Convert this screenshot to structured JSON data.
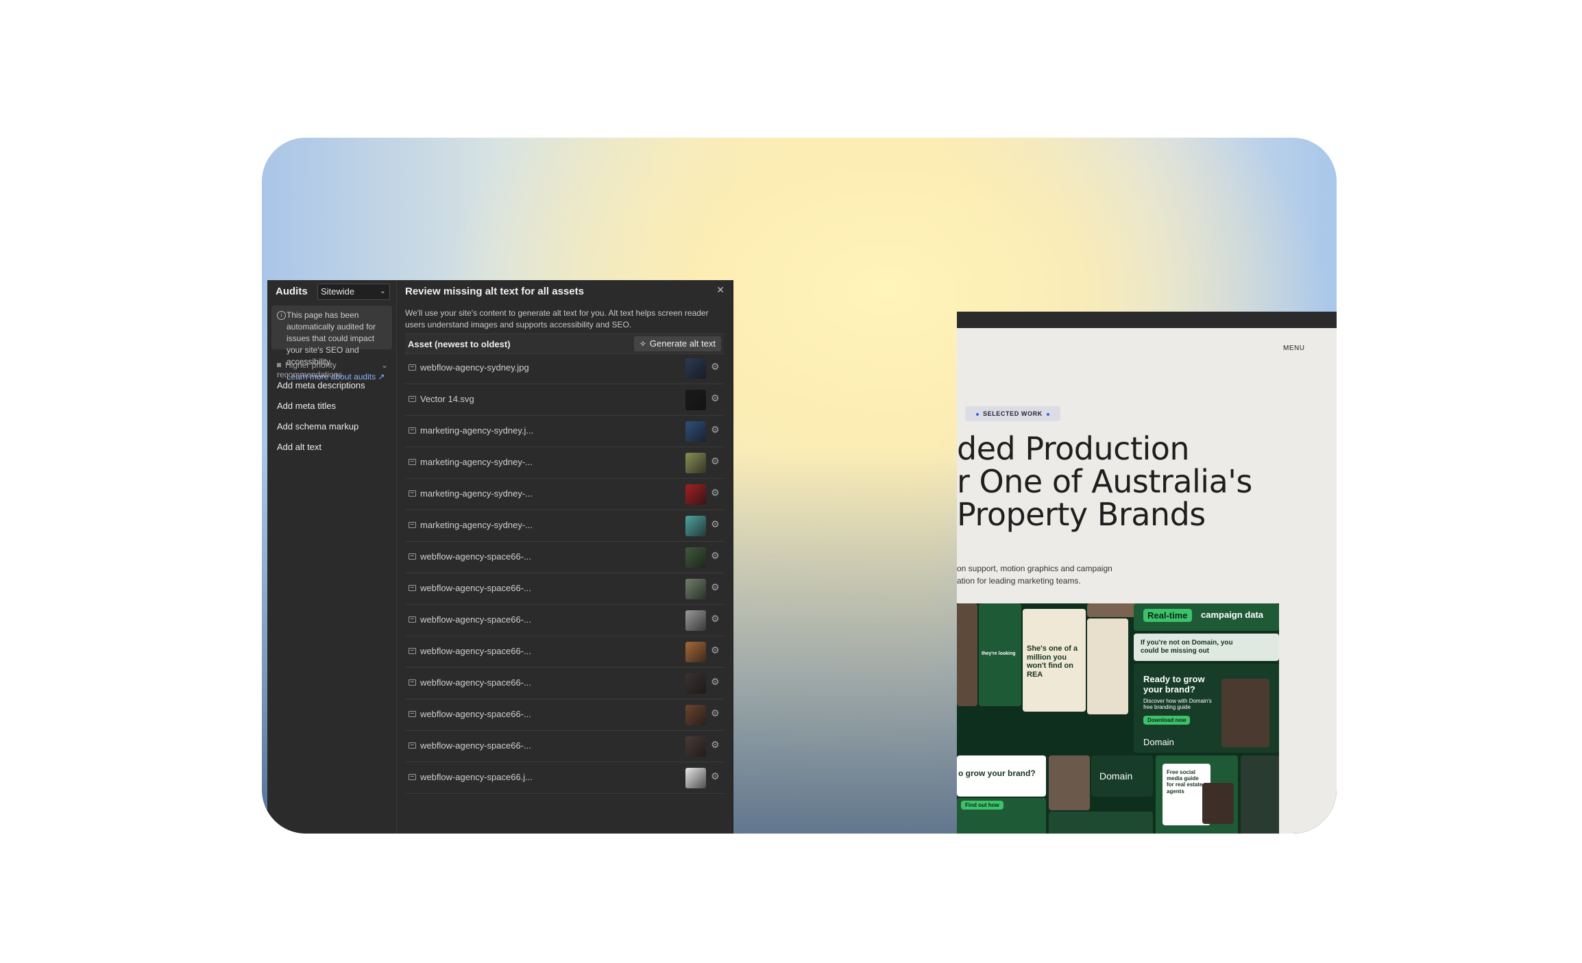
{
  "audits": {
    "title": "Audits",
    "scope": "Sitewide",
    "info_text": "This page has been automatically audited for issues that could impact your site's SEO and accessibility.",
    "learn_more": "Learn more about audits ↗",
    "priority_label": "Higher priority recommendations",
    "recommendations": [
      "Add meta descriptions",
      "Add meta titles",
      "Add schema markup",
      "Add alt text"
    ]
  },
  "modal": {
    "title": "Review missing alt text for all assets",
    "description": "We'll use your site's content to generate alt text for you. Alt text helps screen reader users understand images and supports accessibility and SEO.",
    "column_header": "Asset (newest to oldest)",
    "generate_button": "Generate alt text",
    "assets": [
      {
        "name": "webflow-agency-sydney.jpg",
        "thumb": "#2b3a55"
      },
      {
        "name": "Vector 14.svg",
        "thumb": "#1a1a1a"
      },
      {
        "name": "marketing-agency-sydney.j...",
        "thumb": "#2f4f7a"
      },
      {
        "name": "marketing-agency-sydney-...",
        "thumb": "#8a8f55"
      },
      {
        "name": "marketing-agency-sydney-...",
        "thumb": "#a31f24"
      },
      {
        "name": "marketing-agency-sydney-...",
        "thumb": "#4fa3a0"
      },
      {
        "name": "webflow-agency-space66-...",
        "thumb": "#3f5a3a"
      },
      {
        "name": "webflow-agency-space66-...",
        "thumb": "#6f7f6a"
      },
      {
        "name": "webflow-agency-space66-...",
        "thumb": "#9a9a9a"
      },
      {
        "name": "webflow-agency-space66-...",
        "thumb": "#a6683a"
      },
      {
        "name": "webflow-agency-space66-...",
        "thumb": "#3a3330"
      },
      {
        "name": "webflow-agency-space66-...",
        "thumb": "#6a4330"
      },
      {
        "name": "webflow-agency-space66-...",
        "thumb": "#4a3a35"
      },
      {
        "name": "webflow-agency-space66.j...",
        "thumb": "#e8e8e8"
      }
    ]
  },
  "preview": {
    "breakpoint": "1258px",
    "menu": "MENU",
    "pill": "SELECTED WORK",
    "headline": [
      "ded Production",
      "r One of Australia's",
      "Property Brands"
    ],
    "paragraph": [
      "on support, motion graphics and campaign",
      "ation for leading marketing teams."
    ],
    "collage": {
      "realtime": "Real-time",
      "campaign": "campaign data",
      "million": "She's one of a million you won't find on REA",
      "notondomain": "If you're not on Domain, you could be missing out",
      "grow": "Ready to grow your brand?",
      "discover": "Discover how with Domain's free branding guide",
      "download": "Download now",
      "domain": "Domain",
      "grow2": "o grow your brand?",
      "findout": "Find out how",
      "freesocial": "Free social media guide for real estate agents",
      "theyre": "they're looking"
    }
  },
  "colors": {
    "accent_green": "#3ec16b",
    "link_blue": "#8ab4ff",
    "panel_bg": "#2b2b2b"
  }
}
